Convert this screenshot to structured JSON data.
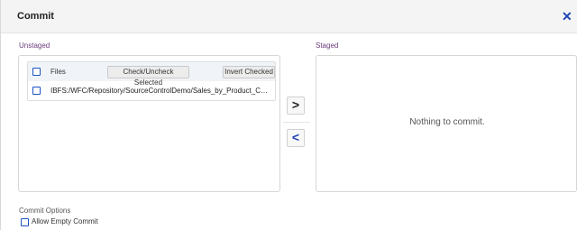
{
  "dialog": {
    "title": "Commit",
    "close_icon": "close-icon"
  },
  "unstaged": {
    "label": "Unstaged",
    "table": {
      "header": {
        "files_label": "Files",
        "check_selected_label": "Check/Uncheck Selected",
        "invert_checked_label": "Invert Checked"
      },
      "rows": [
        {
          "path": "IBFS:/WFC/Repository/SourceControlDemo/Sales_by_Product_Cat...",
          "checked": false
        }
      ]
    }
  },
  "transfer": {
    "stage_label": ">",
    "unstage_label": "<"
  },
  "staged": {
    "label": "Staged",
    "empty_message": "Nothing to commit."
  },
  "commit_options": {
    "label": "Commit Options",
    "allow_empty_label": "Allow Empty Commit",
    "allow_empty_checked": false
  },
  "colors": {
    "accent": "#1f43b8",
    "section_label": "#6c3b7e",
    "checkbox_border": "#1b53c6"
  }
}
